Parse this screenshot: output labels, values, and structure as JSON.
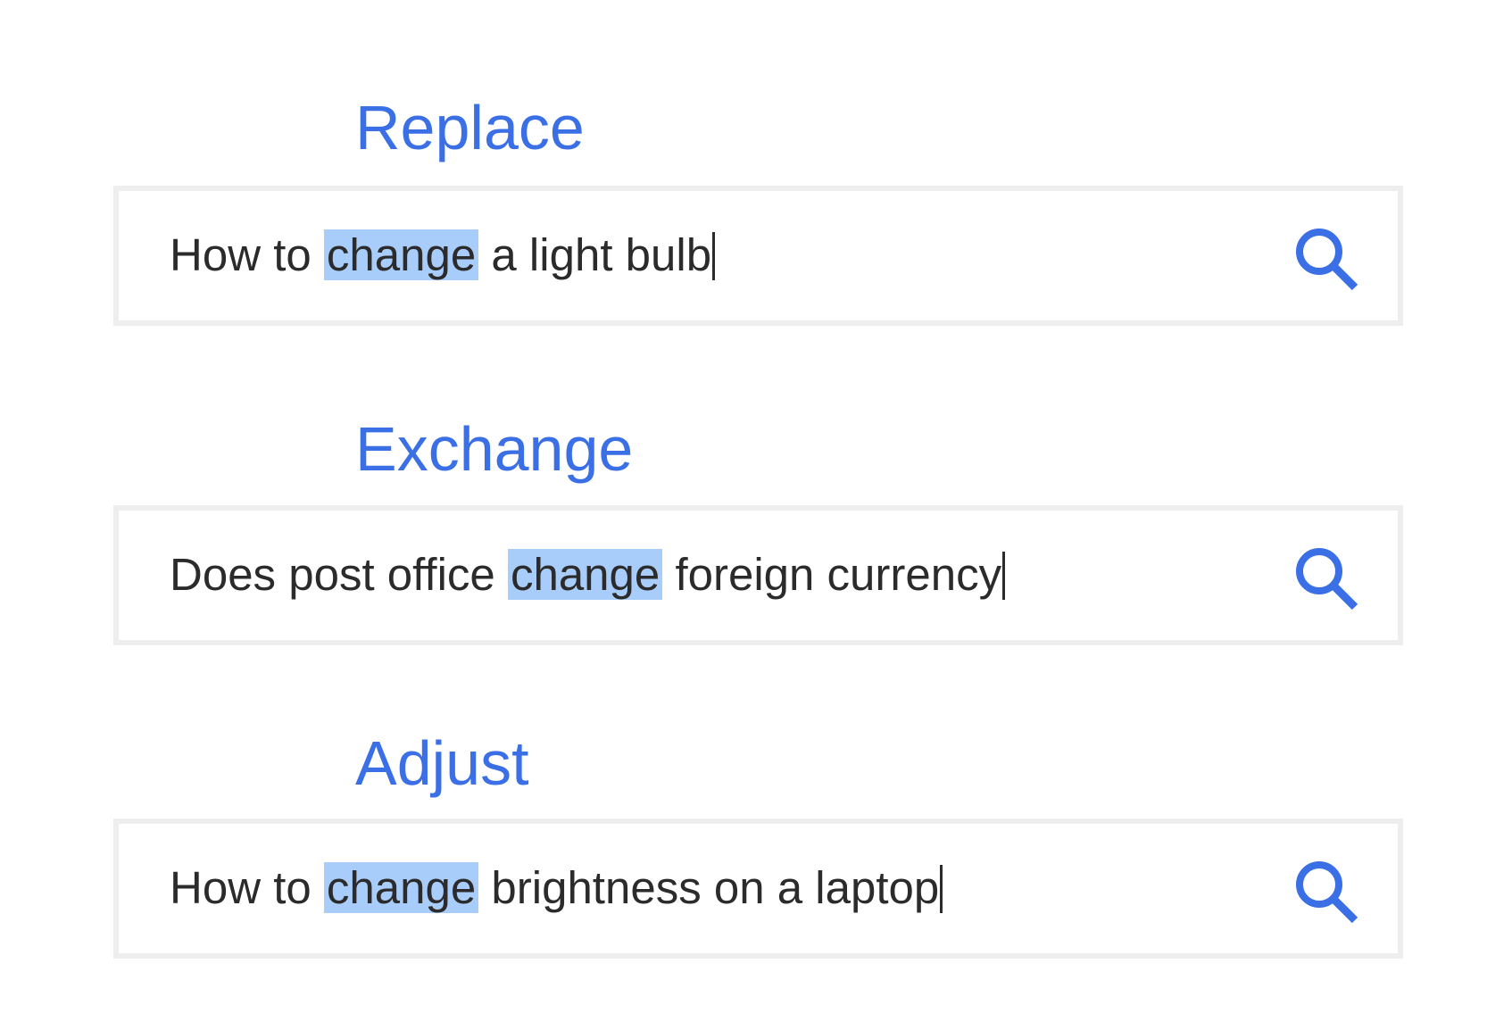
{
  "accent_color": "#3b6fe6",
  "highlight_color": "#a9cdfb",
  "groups": [
    {
      "heading": "Replace",
      "query_before": "How to ",
      "query_highlight": "change",
      "query_after": " a light bulb",
      "icon": "search-icon"
    },
    {
      "heading": "Exchange",
      "query_before": "Does post office ",
      "query_highlight": "change",
      "query_after": " foreign currency",
      "icon": "search-icon"
    },
    {
      "heading": "Adjust",
      "query_before": "How to ",
      "query_highlight": "change",
      "query_after": " brightness on a laptop",
      "icon": "search-icon"
    }
  ]
}
